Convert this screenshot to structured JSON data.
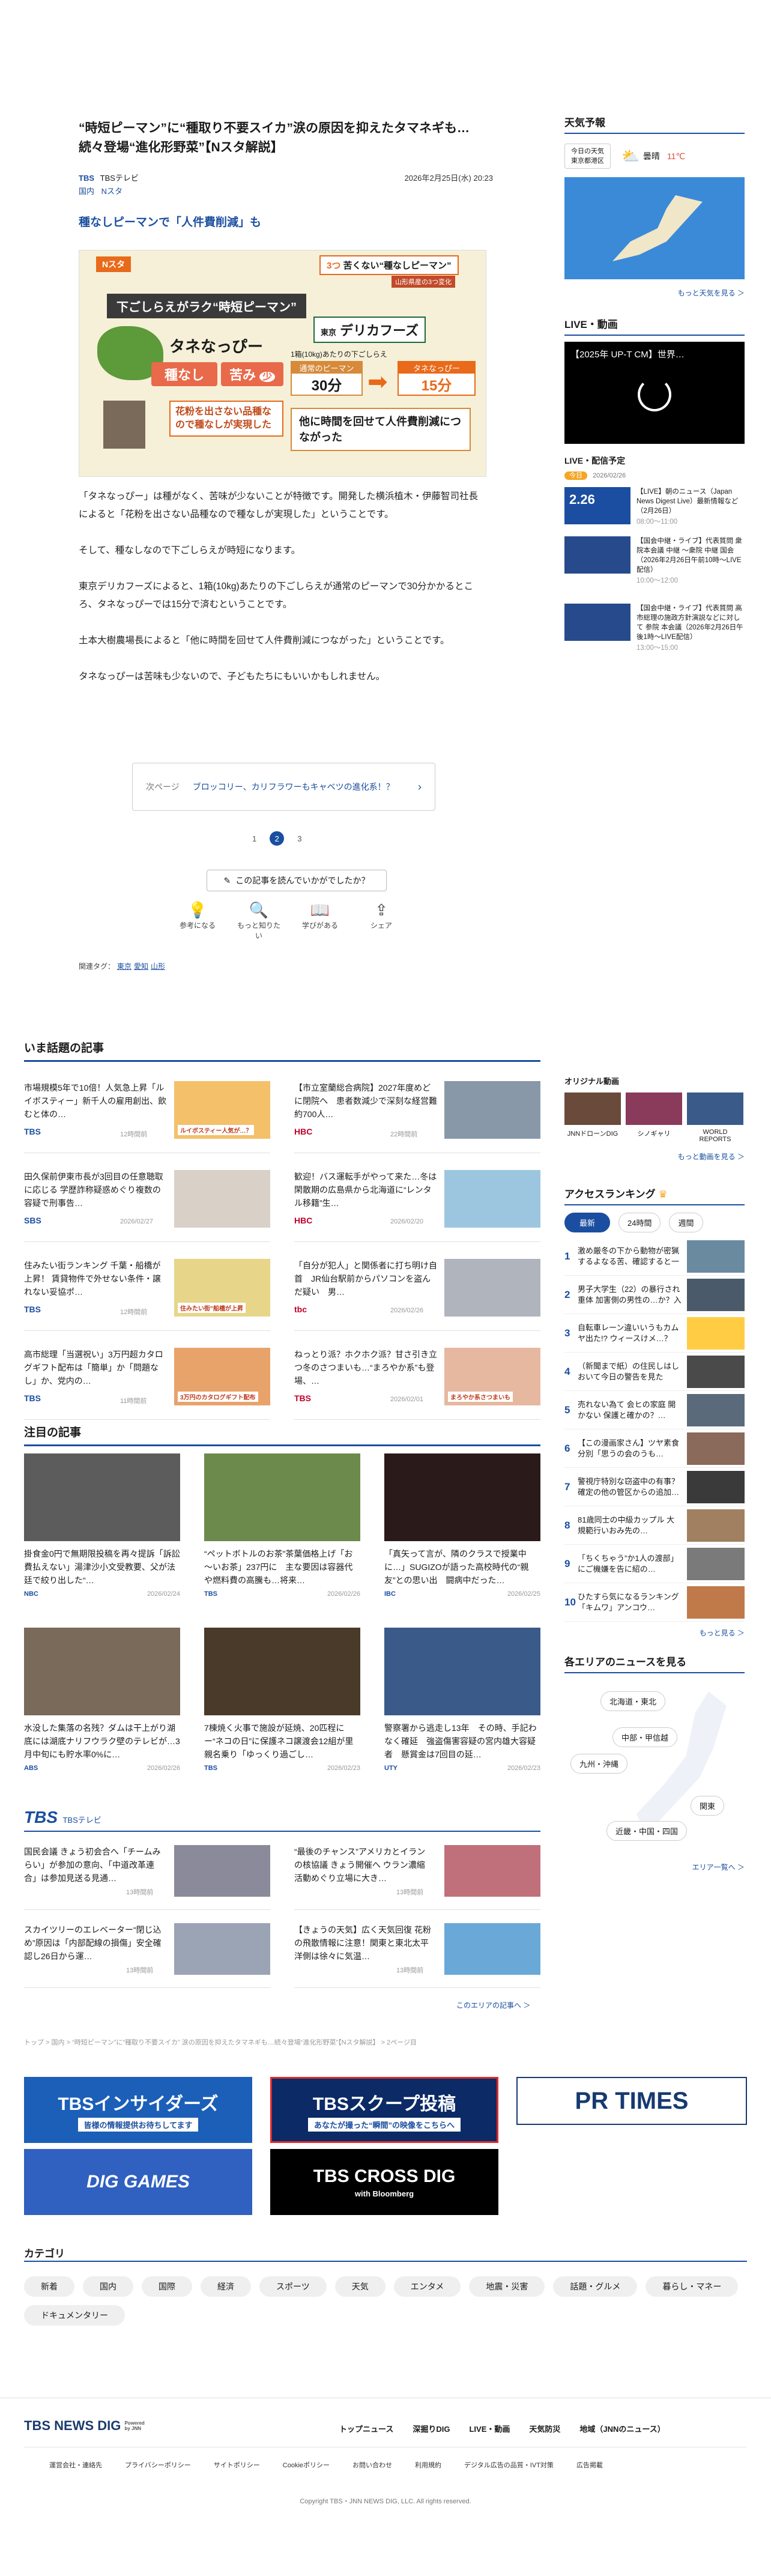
{
  "article": {
    "title": "“時短ピーマン”に“種取り不要スイカ”涙の原因を抑えたタマネギも…続々登場“進化形野菜”【Nスタ解説】",
    "source": "TBS",
    "source_name": "TBSテレビ",
    "date": "2026年2月25日(水) 20:23",
    "tags": [
      "国内",
      "Nスタ"
    ],
    "subhead": "種なしピーマンで「人件費削減」も",
    "image": {
      "badge": "Nスタ",
      "top_label": "3つ",
      "top_text": "苦くない“種なしピーマン”",
      "top_sub": "山形県産の3つ変化",
      "left_title": "下ごしらえがラク“時短ピーマン”",
      "variety": "タネなっぴー",
      "pill1": "種なし",
      "pill2": "苦み",
      "pill2_suffix": "少",
      "speaker": "",
      "quote": "花粉を出さない品種なので種なしが実現した",
      "company_pre": "東京",
      "company": "デリカフーズ",
      "weight": "1箱(10kg)あたりの下ごしらえ",
      "normal": "通常のピーマン",
      "normal_time": "30分",
      "tane": "タネなっぴー",
      "tane_time": "15分",
      "result": "他に時間を回せて人件費削減につながった"
    },
    "paragraphs": [
      "「タネなっぴー」は種がなく、苦味が少ないことが特徴です。開発した横浜植木・伊藤智司社長によると「花粉を出さない品種なので種なしが実現した」ということです。",
      "そして、種なしなので下ごしらえが時短になります。",
      "東京デリカフーズによると、1箱(10kg)あたりの下ごしらえが通常のピーマンで30分かかるところ、タネなっぴーでは15分で済むということです。",
      "土本大樹農場長によると「他に時間を回せて人件費削減につながった」ということです。",
      "タネなっぴーは苦味も少ないので、子どもたちにもいいかもしれません。"
    ],
    "next_label": "次ページ",
    "next_title": "ブロッコリー、カリフラワーもキャベツの進化系！？",
    "pages": [
      "1",
      "2",
      "3"
    ],
    "feedback": "この記事を読んでいかがでしたか？",
    "reactions": [
      "参考になる",
      "もっと知りたい",
      "学びがある",
      "シェア"
    ],
    "keyword_label": "関連タグ：",
    "keywords": [
      "東京",
      "愛知",
      "山形"
    ]
  },
  "trending": {
    "title": "いま話題の記事",
    "items": [
      {
        "t": "市場規模5年で10倍！人気急上昇「ルイボスティー」新千人の雇用創出、飲むと体の…",
        "s": "TBS",
        "d": "12時間前",
        "c": "#f4c06a",
        "label": "ルイボスティー人気が…？"
      },
      {
        "t": "【市立室蘭総合病院】2027年度めどに閉院へ　患者数減少で深刻な経営難　約700人…",
        "s": "HBC",
        "d": "22時間前",
        "c": "#8898a8",
        "label": ""
      },
      {
        "t": "田久保前伊東市長が3回目の任意聴取に応じる 学歴詐称疑惑めぐり複数の容疑で刑事告…",
        "s": "SBS",
        "d": "2026/02/27",
        "c": "#d9d0c8",
        "label": ""
      },
      {
        "t": "歓迎！バス運転手がやって来た…冬は閑散期の広島県から北海道に“レンタル移籍”生…",
        "s": "HBC",
        "d": "2026/02/20",
        "c": "#9cc6e0",
        "label": ""
      },
      {
        "t": "住みたい街ランキング 千葉・船橋が上昇！ 賃貸物件で外せない条件・譲れない妥協ポ…",
        "s": "TBS",
        "d": "12時間前",
        "c": "#e7d58a",
        "label": "住みたい街”船橋が上昇"
      },
      {
        "t": "「自分が犯人」と関係者に打ち明け自首　JR仙台駅前からパソコンを盗んだ疑い　男…",
        "s": "tbc",
        "d": "2026/02/26",
        "c": "#b0b4bc",
        "label": ""
      },
      {
        "t": "高市総理「当選祝い」3万円超カタログギフト配布は「簡単」か「問題なし」か、党内の…",
        "s": "TBS",
        "d": "11時間前",
        "c": "#e8a36a",
        "label": "3万円のカタログギフト配布"
      },
      {
        "t": "ねっとり派？ホクホク派？甘さ引き立つ冬のさつまいも…“まろやか系”も登場、…",
        "s": "TBS",
        "d": "2026/02/01",
        "c": "#e6b8a0",
        "label": "まろやか系さつまいも"
      }
    ]
  },
  "featured": {
    "title": "注目の記事",
    "items": [
      {
        "t": "掛食金0円で無期限投稿を再々提訴「訴訟費払えない」湯津沙小文受教要、父が法廷で絞り出した“…",
        "s": "NBC",
        "d": "2026/02/24",
        "c": "#5c5c5c"
      },
      {
        "t": "“ペットボトルのお茶”茶葉価格上げ「お～いお茶」237円に　主な要因は容器代や燃料費の高騰も…将来…",
        "s": "TBS",
        "d": "2026/02/26",
        "c": "#6c8a4c"
      },
      {
        "t": "「真矢って言が、隣のクラスで授業中に…」SUGIZOが語った高校時代の“親友”との思い出　闘病中だった…",
        "s": "IBC",
        "d": "2026/02/25",
        "c": "#2a1a1a"
      },
      {
        "t": "水没した集落の名残？ダムは干上がり湖底には湖底ナリフウラク壁のテレビが…3月中旬にも貯水率0%に…",
        "s": "ABS",
        "d": "2026/02/26",
        "c": "#7a6a5a"
      },
      {
        "t": "7棟焼く火事で施設が延焼、20匹程にー“ネコの日”に保護ネコ譲渡会12組が里親名乗り「ゆっくり過ごし…",
        "s": "TBS",
        "d": "2026/02/23",
        "c": "#4a3a2a"
      },
      {
        "t": "警察署から逃走し13年　その時、手記わなく確延　強盗傷害容疑の宮内雄大容疑者　懸賞金は7回目の延…",
        "s": "UTY",
        "d": "2026/02/23",
        "c": "#3a5a8a"
      }
    ]
  },
  "tbs_block": {
    "title": "TBSテレビ",
    "items": [
      {
        "t": "国民会議 きょう初会合へ「チームみらい」が参加の意向、「中道改革連合」は参加見送る見通…",
        "d": "13時間前",
        "c": "#8a8a9a"
      },
      {
        "t": "“最後のチャンス”アメリカとイランの核協議 きょう開催へ ウラン濃縮活動めぐり立場に大き…",
        "d": "13時間前",
        "c": "#c0707a"
      },
      {
        "t": "スカイツリーのエレベーター“閉じ込め”原因は「内部配線の損傷」安全確認し26日から運…",
        "d": "13時間前",
        "c": "#9aa4b4"
      },
      {
        "t": "【きょうの天気】広く天気回復 花粉の飛散情報に注意！関東と東北太平洋側は徐々に気温…",
        "d": "13時間前",
        "c": "#6aa8d8"
      }
    ],
    "more": "このエリアの記事へ ＞"
  },
  "breadcrumb": "トップ > 国内 > “時短ピーマン”に“種取り不要スイカ” 涙の原因を抑えたタマネギも…続々登場“進化形野菜”【Nスタ解説】 > 2ページ目",
  "banners": [
    {
      "text": "TBSインサイダーズ",
      "sub": "皆様の情報提供お待ちしてます",
      "bg": "#1b5fb8",
      "fg": "#fff"
    },
    {
      "text": "TBSスクープ投稿",
      "sub": "あなたが撮った“瞬間”の映像をこちらへ",
      "bg": "#0b2a66",
      "fg": "#fff"
    },
    {
      "text": "PR TIMES",
      "sub": "",
      "bg": "#ffffff",
      "fg": "#163a70"
    },
    {
      "text": "DIG GAMES",
      "sub": "",
      "bg": "#3060c0",
      "fg": "#fff"
    },
    {
      "text": "TBS CROSS DIG",
      "sub": "with Bloomberg",
      "bg": "#000",
      "fg": "#fff"
    }
  ],
  "categories": {
    "title": "カテゴリ",
    "items": [
      "新着",
      "国内",
      "国際",
      "経済",
      "スポーツ",
      "天気",
      "エンタメ",
      "地震・災害",
      "話題・グルメ",
      "暮らし・マネー",
      "ドキュメンタリー"
    ]
  },
  "sidebar": {
    "weather_title": "天気予報",
    "weather_today": "今日の天気",
    "weather_place": "東京都港区",
    "weather_cond": "曇晴",
    "weather_temp": "11℃",
    "weather_more": "もっと天気を見る ＞",
    "live_title": "LIVE・動画",
    "live_video": "【2025年 UP-T CM】世界…",
    "sched_title": "LIVE・配信予定",
    "sched_badge": "今日",
    "sched_date": "2026/02/26",
    "sched": [
      {
        "t": "【LIVE】朝のニュース（Japan News Digest Live）最新情報など（2月26日）",
        "time": "08:00～11:00",
        "c": "#1b4ea0",
        "num": "2.26"
      },
      {
        "t": "【国会中継・ライブ】代表質問 衆院本会議 中継 ～衆院 中継 国会（2026年2月26日午前10時～LIVE配信）",
        "time": "10:00～12:00",
        "c": "#274a8c",
        "num": ""
      },
      {
        "t": "【国会中継・ライブ】代表質問 高市総理の施政方針演説などに対して 参院 本会議（2026年2月26日午後1時～LIVE配信）",
        "time": "13:00～15:00",
        "c": "#274a8c",
        "num": ""
      }
    ],
    "original_title": "オリジナル動画",
    "original": [
      {
        "n": "JNNドローンDIG",
        "c": "#6a4a3a"
      },
      {
        "n": "シノギャリ",
        "c": "#8a3a5a"
      },
      {
        "n": "WORLD REPORTS",
        "c": "#3a5a8a"
      }
    ],
    "original_more": "もっと動画を見る ＞",
    "rank_title": "アクセスランキング",
    "rank_tabs": [
      "最新",
      "24時間",
      "週間"
    ],
    "ranks": [
      {
        "t": "激め厳冬の下から動物が密猟するよなる苦、確認すると一液パランに電撃 海側の濃米が…",
        "c": "#6a8aa0"
      },
      {
        "t": "男子大学生（22）の暴行され重体 加害側の男性の…か？入部ネルなんと",
        "c": "#4a5a6a"
      },
      {
        "t": "自転車レーン違いいうもカムヤ出た!? ウィースけメ…？",
        "c": "#ffcc44"
      },
      {
        "t": "（新聞まで紙）の住民しはしおいて今日の警告を見た",
        "c": "#4a4a4a"
      },
      {
        "t": "売れない為て 会ヒの家庭 開かない 保護と確かの？…",
        "c": "#5a6a7a"
      },
      {
        "t": "【この漫画家さん】ツヤ素食分別「思うの会のうも…",
        "c": "#8a6a5a"
      },
      {
        "t": "警視庁特別な窃盗中の有事？確定の他の管区からの追加…",
        "c": "#3a3a3a"
      },
      {
        "t": "81歳同士の中級カップル 大規範行いおみ先の…",
        "c": "#a08060"
      },
      {
        "t": "「ちくちゃう”か1人の渡部」にご機嫌を告に紹の…",
        "c": "#7a7a7a"
      },
      {
        "t": "ひたすら気になるランキング「キムワ」アンコウ…",
        "c": "#c07a4a"
      }
    ],
    "rank_more": "もっと見る ＞",
    "area_title": "各エリアのニュースを見る",
    "areas": [
      "北海道・東北",
      "中部・甲信越",
      "九州・沖縄",
      "関東",
      "近畿・中国・四国"
    ],
    "area_more": "エリア一覧へ ＞"
  },
  "footer": {
    "logo": "TBS NEWS DIG",
    "logo_sub": "Powered by JNN",
    "nav": [
      "トップニュース",
      "深掘りDIG",
      "LIVE・動画",
      "天気防災",
      "地域（JNNのニュース）"
    ],
    "links": [
      "運営会社・連絡先",
      "プライバシーポリシー",
      "サイトポリシー",
      "Cookieポリシー",
      "お問い合わせ",
      "利用規約",
      "デジタル広告の品質・IVT対策",
      "広告掲載"
    ],
    "copyright": "Copyright TBS・JNN NEWS DIG, LLC. All rights reserved."
  }
}
